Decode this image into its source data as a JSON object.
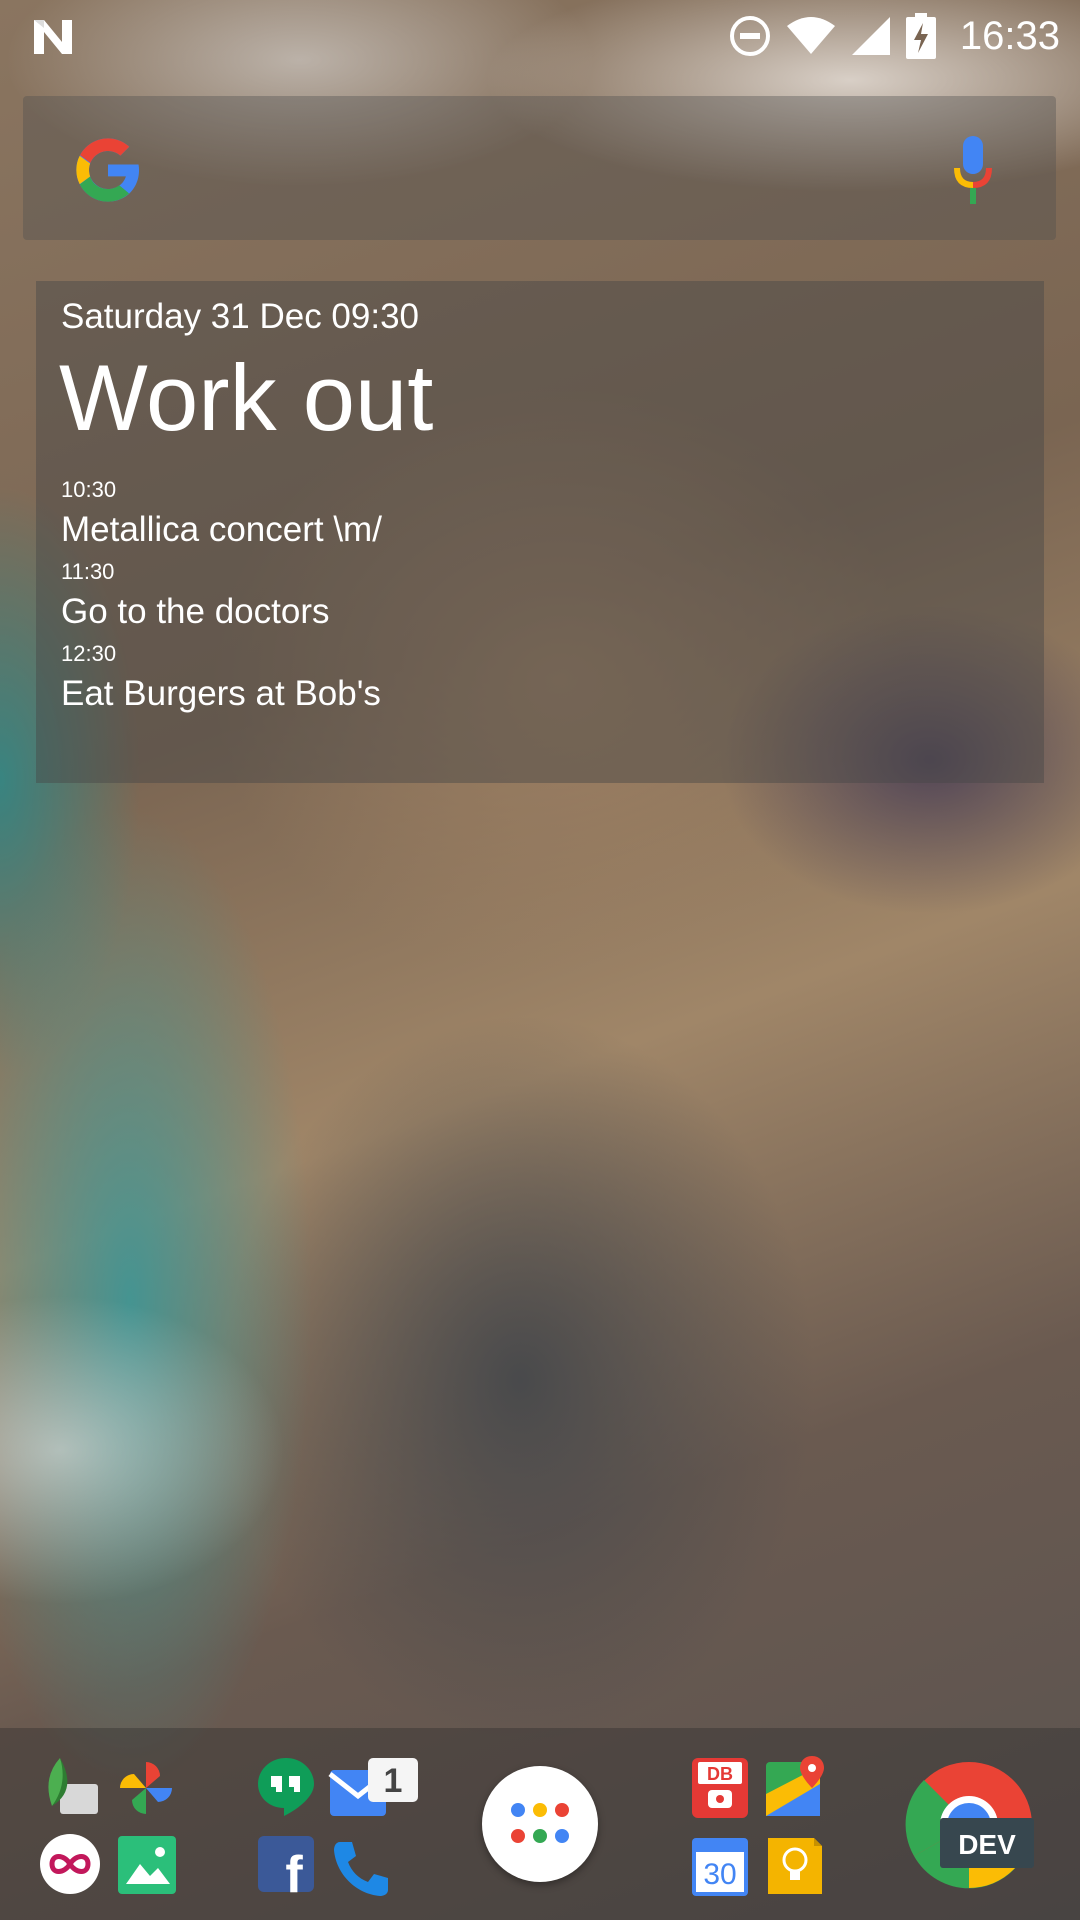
{
  "status_bar": {
    "time": "16:33",
    "icons": [
      "n-notification-icon",
      "do-not-disturb-icon",
      "wifi-icon",
      "cell-signal-icon",
      "battery-charging-icon"
    ]
  },
  "search_bar": {
    "logo_letter": "G",
    "icons": [
      "google-logo-icon",
      "microphone-icon"
    ]
  },
  "agenda": {
    "date": "Saturday 31 Dec 09:30",
    "headline": "Work out",
    "events": [
      {
        "time": "10:30",
        "title": "Metallica concert \\m/"
      },
      {
        "time": "11:30",
        "title": "Go to the doctors"
      },
      {
        "time": "12:30",
        "title": "Eat Burgers at Bob's"
      }
    ]
  },
  "dock": {
    "apps": [
      "leaf-app-icon",
      "photos-pinwheel-icon",
      "infinity-app-icon",
      "gallery-app-icon",
      "hangouts-icon",
      "inbox-mail-icon",
      "facebook-icon",
      "phone-icon",
      "app-drawer-icon",
      "db-navigator-icon",
      "maps-icon",
      "calendar-icon",
      "keep-bulb-icon",
      "chrome-dev-icon"
    ],
    "mail_badge": "1",
    "calendar_day": "30",
    "db_label": "DB",
    "chrome_label": "DEV",
    "facebook_letter": "f"
  },
  "colors": {
    "google_blue": "#4285F4",
    "google_red": "#EA4335",
    "google_yellow": "#FBBC05",
    "google_green": "#34A853"
  }
}
